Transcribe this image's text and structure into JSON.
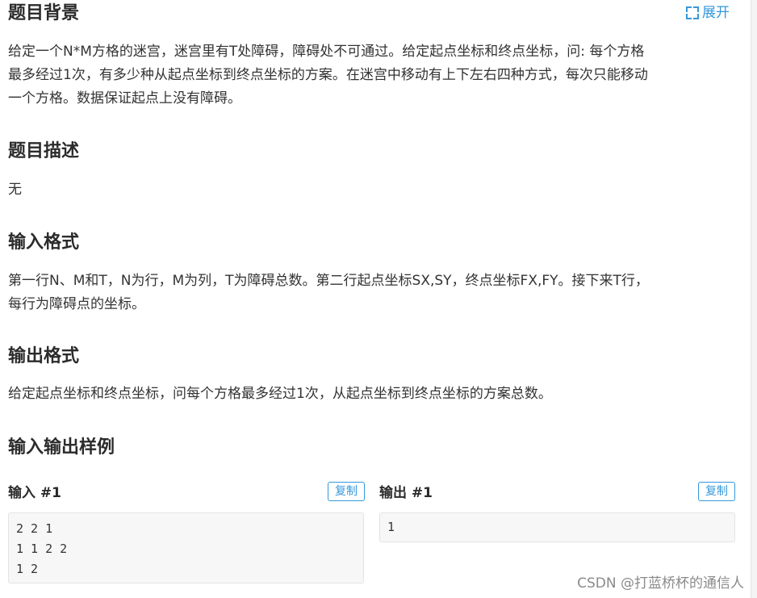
{
  "expand_label": "展开",
  "sections": {
    "background": {
      "title": "题目背景",
      "lines": [
        "给定一个N*M方格的迷宫，迷宫里有T处障碍，障碍处不可通过。给定起点坐标和终点坐标，问: 每个方格",
        "最多经过1次，有多少种从起点坐标到终点坐标的方案。在迷宫中移动有上下左右四种方式，每次只能移动",
        "一个方格。数据保证起点上没有障碍。"
      ]
    },
    "description": {
      "title": "题目描述",
      "text": "无"
    },
    "input_format": {
      "title": "输入格式",
      "lines": [
        "第一行N、M和T，N为行，M为列，T为障碍总数。第二行起点坐标SX,SY，终点坐标FX,FY。接下来T行，",
        "每行为障碍点的坐标。"
      ]
    },
    "output_format": {
      "title": "输出格式",
      "text": "给定起点坐标和终点坐标，问每个方格最多经过1次，从起点坐标到终点坐标的方案总数。"
    },
    "samples": {
      "title": "输入输出样例",
      "input": {
        "label": "输入 #1",
        "copy_label": "复制",
        "lines": [
          "2 2 1",
          "1 1 2 2",
          "1 2"
        ]
      },
      "output": {
        "label": "输出 #1",
        "copy_label": "复制",
        "lines": [
          "1"
        ]
      }
    }
  },
  "watermark": "CSDN @打蓝桥杯的通信人",
  "colors": {
    "accent": "#3498db",
    "code_bg": "#f7f7f7",
    "title": "#2b2b2b"
  }
}
